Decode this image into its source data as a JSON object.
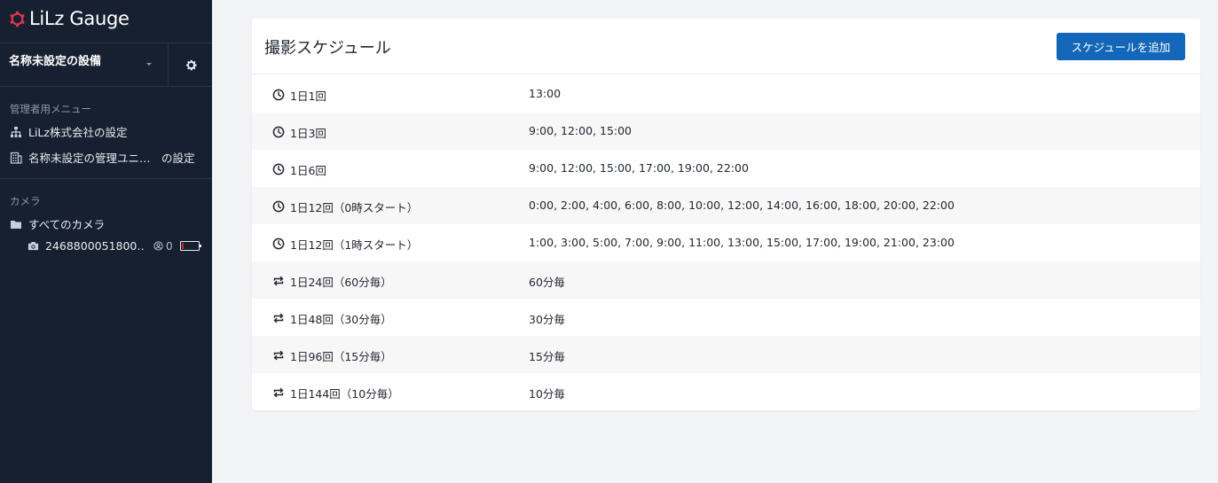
{
  "sidebar": {
    "logo_text": "LiLz Gauge",
    "device_name": "名称未設定の設備",
    "admin_section_label": "管理者用メニュー",
    "admin_items": [
      {
        "label": "LiLz株式会社の設定",
        "icon": "sitemap-icon"
      },
      {
        "label": "名称未設定の管理ユニ…　の設定",
        "icon": "building-icon"
      }
    ],
    "camera_section_label": "カメラ",
    "all_cameras_label": "すべてのカメラ",
    "camera": {
      "id": "2468800051800…",
      "count": "0",
      "battery_level": 0.12,
      "battery_color": "#e02020"
    }
  },
  "main": {
    "title": "撮影スケジュール",
    "add_button_label": "スケジュールを追加",
    "accent_color": "#1466b8",
    "schedules": [
      {
        "icon": "clock-icon",
        "name": "1日1回",
        "times": "13:00"
      },
      {
        "icon": "clock-icon",
        "name": "1日3回",
        "times": "9:00, 12:00, 15:00"
      },
      {
        "icon": "clock-icon",
        "name": "1日6回",
        "times": "9:00, 12:00, 15:00, 17:00, 19:00, 22:00"
      },
      {
        "icon": "clock-icon",
        "name": "1日12回（0時スタート）",
        "times": "0:00, 2:00, 4:00, 6:00, 8:00, 10:00, 12:00, 14:00, 16:00, 18:00, 20:00, 22:00"
      },
      {
        "icon": "clock-icon",
        "name": "1日12回（1時スタート）",
        "times": "1:00, 3:00, 5:00, 7:00, 9:00, 11:00, 13:00, 15:00, 17:00, 19:00, 21:00, 23:00"
      },
      {
        "icon": "repeat-icon",
        "name": "1日24回（60分毎）",
        "times": "60分毎"
      },
      {
        "icon": "repeat-icon",
        "name": "1日48回（30分毎）",
        "times": "30分毎"
      },
      {
        "icon": "repeat-icon",
        "name": "1日96回（15分毎）",
        "times": "15分毎"
      },
      {
        "icon": "repeat-icon",
        "name": "1日144回（10分毎）",
        "times": "10分毎"
      }
    ]
  }
}
